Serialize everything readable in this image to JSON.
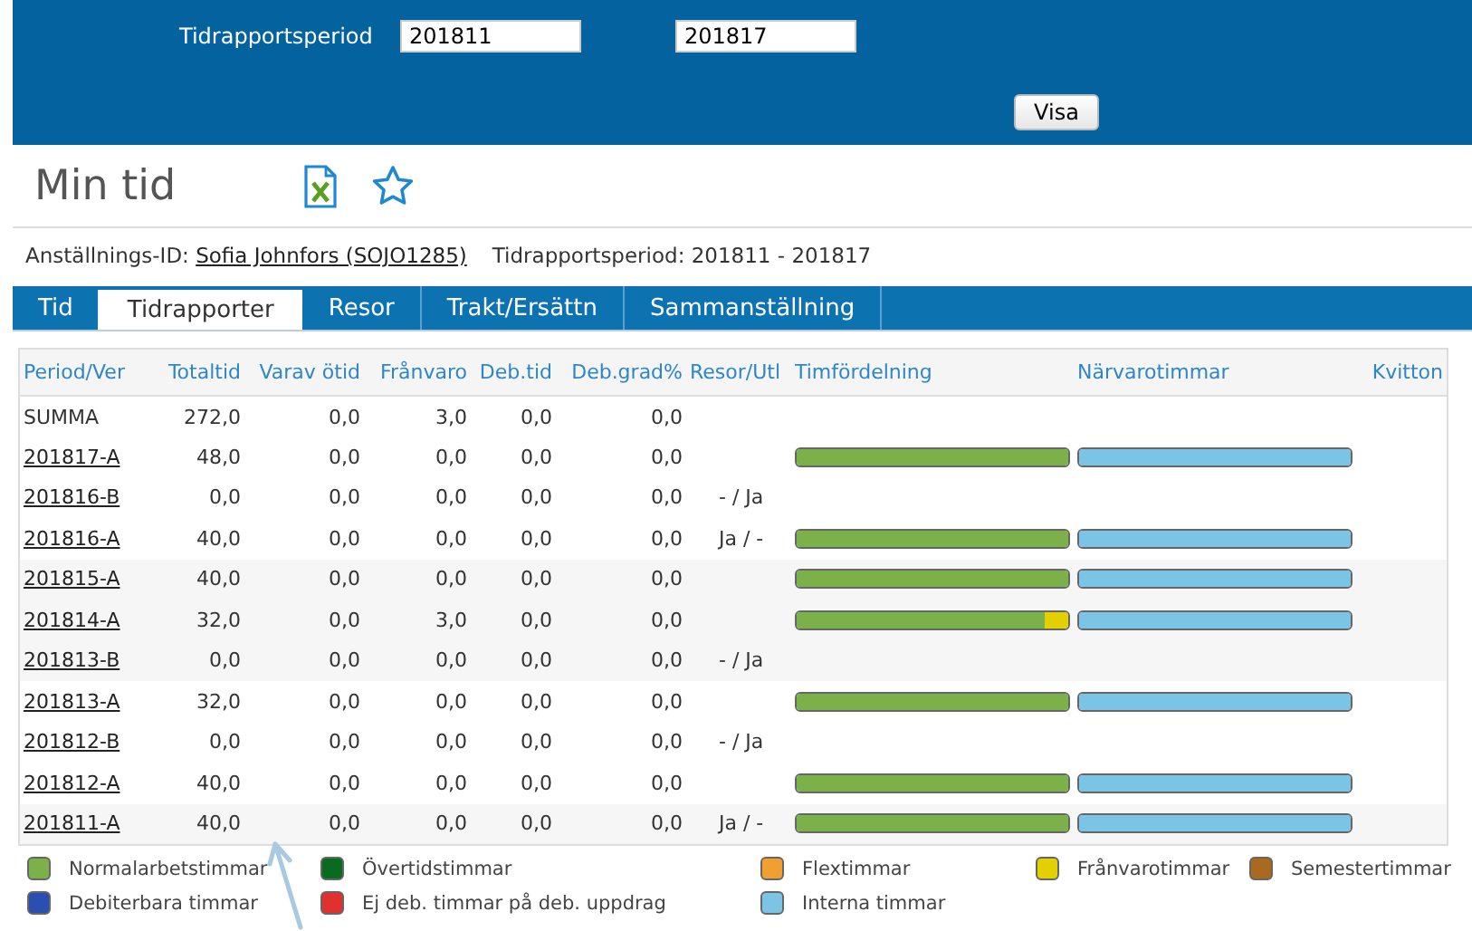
{
  "filter": {
    "label": "Tidrapportsperiod",
    "from": "201811",
    "to": "201817",
    "button": "Visa"
  },
  "page_title": "Min tid",
  "info": {
    "employee_label": "Anställnings-ID:",
    "employee": "Sofia Johnfors (SOJO1285)",
    "period": "Tidrapportsperiod: 201811 - 201817"
  },
  "tabs": [
    {
      "label": "Tid",
      "selected": false
    },
    {
      "label": "Tidrapporter",
      "selected": true
    },
    {
      "label": "Resor",
      "selected": false
    },
    {
      "label": "Trakt/Ersättn",
      "selected": false
    },
    {
      "label": "Sammanställning",
      "selected": false
    }
  ],
  "table": {
    "columns": [
      "Period/Ver",
      "Totaltid",
      "Varav ötid",
      "Frånvaro",
      "Deb.tid",
      "Deb.grad%",
      "Resor/Utl",
      "Timfördelning",
      "Närvarotimmar",
      "Kvitton"
    ],
    "rows": [
      {
        "kind": "sum",
        "period": "SUMMA",
        "total": "272,0",
        "overtime": "0,0",
        "absence": "3,0",
        "billed": "0,0",
        "rate": "0,0"
      },
      {
        "kind": "report",
        "period": "201817-A",
        "total": "48,0",
        "overtime": "0,0",
        "absence": "0,0",
        "billed": "0,0",
        "rate": "0,0",
        "bars": [
          {
            "color": "#7cb14a",
            "level": 1
          }
        ],
        "presence": {
          "level": 1
        }
      },
      {
        "kind": "report",
        "period": "201816-B",
        "total": "0,0",
        "overtime": "0,0",
        "absence": "0,0",
        "billed": "0,0",
        "rate": "0,0",
        "travel": "- / Ja"
      },
      {
        "kind": "report",
        "period": "201816-A",
        "total": "40,0",
        "overtime": "0,0",
        "absence": "0,0",
        "billed": "0,0",
        "rate": "0,0",
        "travel": "Ja / -",
        "bars": [
          {
            "color": "#7cb14a",
            "level": 1
          }
        ],
        "presence": {
          "level": 1
        }
      },
      {
        "kind": "report",
        "period": "201815-A",
        "total": "40,0",
        "overtime": "0,0",
        "absence": "0,0",
        "billed": "0,0",
        "rate": "0,0",
        "bars": [
          {
            "color": "#7cb14a",
            "level": 1
          }
        ],
        "presence": {
          "level": 1
        }
      },
      {
        "kind": "report",
        "period": "201814-A",
        "total": "32,0",
        "overtime": "0,0",
        "absence": "3,0",
        "billed": "0,0",
        "rate": "0,0",
        "bars": [
          {
            "color": "#7cb14a",
            "level": 0.91
          },
          {
            "color": "#e2d000",
            "level": 0.09
          }
        ],
        "presence": {
          "level": 1
        }
      },
      {
        "kind": "report",
        "period": "201813-B",
        "total": "0,0",
        "overtime": "0,0",
        "absence": "0,0",
        "billed": "0,0",
        "rate": "0,0",
        "travel": "- / Ja"
      },
      {
        "kind": "report",
        "period": "201813-A",
        "total": "32,0",
        "overtime": "0,0",
        "absence": "0,0",
        "billed": "0,0",
        "rate": "0,0",
        "bars": [
          {
            "color": "#7cb14a",
            "level": 1
          }
        ],
        "presence": {
          "level": 1
        }
      },
      {
        "kind": "report",
        "period": "201812-B",
        "total": "0,0",
        "overtime": "0,0",
        "absence": "0,0",
        "billed": "0,0",
        "rate": "0,0",
        "travel": "- / Ja"
      },
      {
        "kind": "report",
        "period": "201812-A",
        "total": "40,0",
        "overtime": "0,0",
        "absence": "0,0",
        "billed": "0,0",
        "rate": "0,0",
        "bars": [
          {
            "color": "#7cb14a",
            "level": 1
          }
        ],
        "presence": {
          "level": 1
        }
      },
      {
        "kind": "report",
        "period": "201811-A",
        "total": "40,0",
        "overtime": "0,0",
        "absence": "0,0",
        "billed": "0,0",
        "rate": "0,0",
        "travel": "Ja / -",
        "bars": [
          {
            "color": "#7cb14a",
            "level": 1
          }
        ],
        "presence": {
          "level": 1
        }
      }
    ]
  },
  "legend": [
    {
      "label": "Normalarbetstimmar",
      "color": "#7cb14a"
    },
    {
      "label": "Övertidstimmar",
      "color": "#0a6a1e"
    },
    {
      "label": "Flextimmar",
      "color": "#f0a030"
    },
    {
      "label": "Frånvarotimmar",
      "color": "#e2d000"
    },
    {
      "label": "Semestertimmar",
      "color": "#a86a20"
    },
    {
      "label": "Debiterbara timmar",
      "color": "#2a4fb0"
    },
    {
      "label": "Ej deb. timmar på deb. uppdrag",
      "color": "#e03030"
    },
    {
      "label": "Interna timmar",
      "color": "#7cc4e6"
    }
  ]
}
